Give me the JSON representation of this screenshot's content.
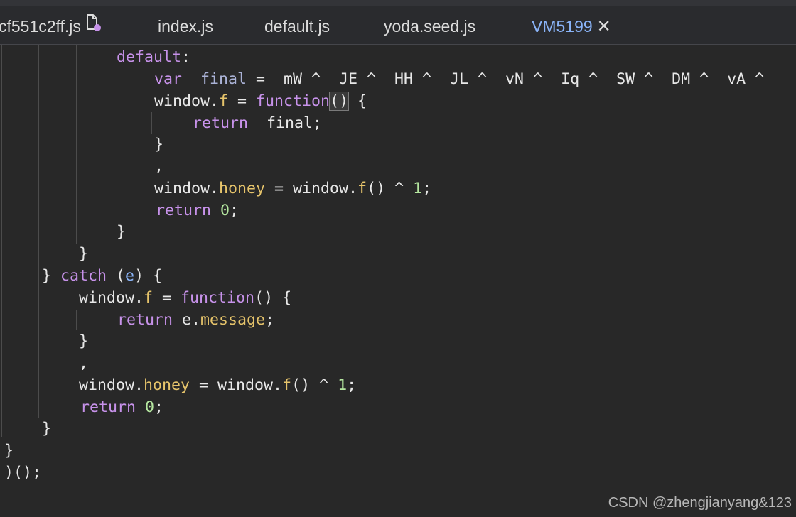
{
  "tabs": [
    {
      "label": "cf551c2ff.js",
      "active": false
    },
    {
      "label": "index.js",
      "active": false
    },
    {
      "label": "default.js",
      "active": false
    },
    {
      "label": "yoda.seed.js",
      "active": false
    },
    {
      "label": "VM5199",
      "active": true
    }
  ],
  "close_glyph": "✕",
  "colors": {
    "background": "#282828",
    "keyword": "#c792ea",
    "property": "#e6c46b",
    "number": "#b5e7a0",
    "active_tab": "#8ab4f8"
  },
  "code": {
    "l1": {
      "t1": "default",
      "t2": ":"
    },
    "l2": {
      "t1": "var",
      "t2": "_final",
      "t3": " = _mW ^ _JE ^ _HH ^ _JL ^ _vN ^ _Iq ^ _SW ^ _DM ^ _vA ^ _"
    },
    "l3": {
      "t1": "window.",
      "t2": "f",
      "t3": " = ",
      "t4": "function",
      "t5": "()",
      "t6": " {"
    },
    "l4": {
      "t1": "return",
      "t2": " _final;"
    },
    "l5": {
      "t1": "}"
    },
    "l6": {
      "t1": ","
    },
    "l7": {
      "t1": "window.",
      "t2": "honey",
      "t3": " = window.",
      "t4": "f",
      "t5": "() ^ ",
      "t6": "1",
      "t7": ";"
    },
    "l8": {
      "t1": "return",
      "t2": "0",
      "t3": ";"
    },
    "l9": {
      "t1": "}"
    },
    "l10": {
      "t1": "}"
    },
    "l11": {
      "t1": "} ",
      "t2": "catch",
      "t3": " (",
      "t4": "e",
      "t5": ") {"
    },
    "l12": {
      "t1": "window.",
      "t2": "f",
      "t3": " = ",
      "t4": "function",
      "t5": "() {"
    },
    "l13": {
      "t1": "return",
      "t2": " e.",
      "t3": "message",
      "t4": ";"
    },
    "l14": {
      "t1": "}"
    },
    "l15": {
      "t1": ","
    },
    "l16": {
      "t1": "window.",
      "t2": "honey",
      "t3": " = window.",
      "t4": "f",
      "t5": "() ^ ",
      "t6": "1",
      "t7": ";"
    },
    "l17": {
      "t1": "return",
      "t2": "0",
      "t3": ";"
    },
    "l18": {
      "t1": "}"
    },
    "l19": {
      "t1": "}"
    },
    "l20": {
      "t1": ")();"
    }
  },
  "watermark": "CSDN @zhengjianyang&123"
}
